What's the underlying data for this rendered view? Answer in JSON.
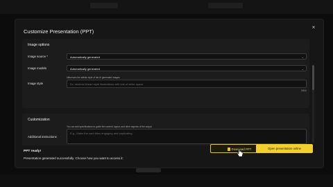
{
  "dialog": {
    "title": "Customize Presentation (PPT)",
    "close_glyph": "×"
  },
  "image_options": {
    "title": "Image options",
    "source_label": "Image source *",
    "source_value": "Automatically generated",
    "models_label": "Image models",
    "models_value": "Automatically generated",
    "style_hint": "Influences the artistic style of the AI generated images.",
    "style_label": "Image style",
    "style_placeholder": "Ex: minimal lineart style illustrations with lots of white space",
    "style_counter": "0/500"
  },
  "customization": {
    "title": "Customization",
    "hint": "You can add specifications to guide the content, layout, and other aspects of the output.",
    "label": "Additional instructions",
    "placeholder": "E.g., Make the card titles engaging and captivating"
  },
  "footer": {
    "status_title": "PPT ready!",
    "status_message": "Presentation generated successfully. Choose how you want to access it:",
    "download_label": "Download PPT",
    "open_label": "Open presentation online"
  },
  "icons": {
    "chevron": "chevron-down-icon",
    "close": "close-icon",
    "download": "file-icon",
    "cursor": "hand-pointer-icon"
  },
  "colors": {
    "accent": "#f2cf2f",
    "background": "#161616"
  }
}
